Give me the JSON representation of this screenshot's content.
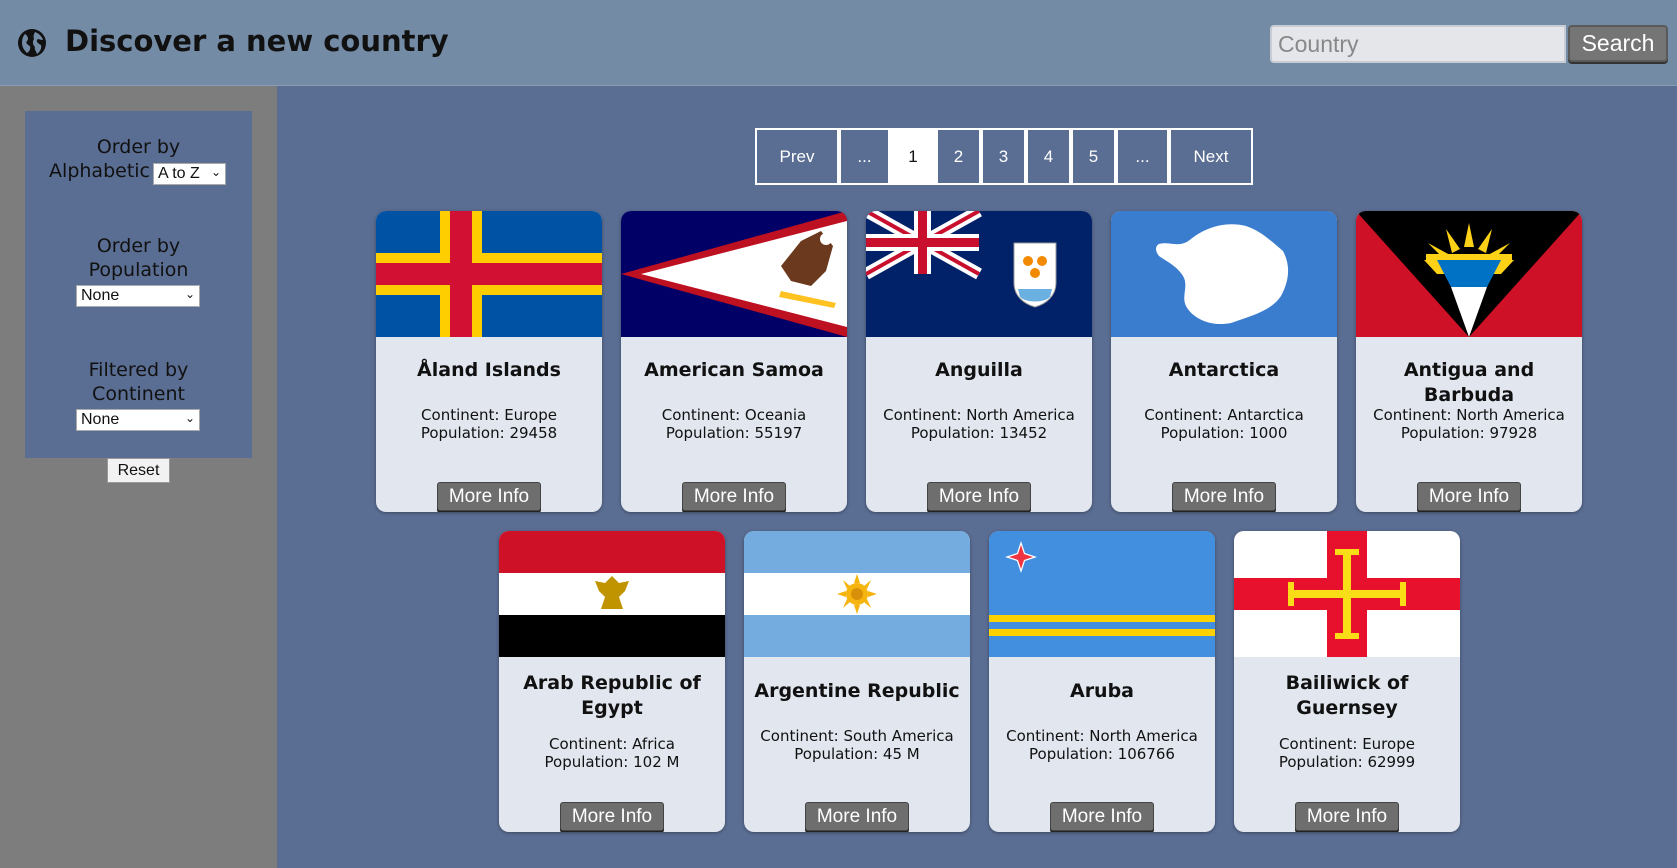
{
  "header": {
    "title": "Discover a new country",
    "search_placeholder": "Country",
    "search_value": "",
    "search_label": "Search"
  },
  "filters": {
    "alphabetic": {
      "label_line1": "Order by",
      "label_line2": "Alphabetic",
      "value": "A to Z"
    },
    "population": {
      "label_line1": "Order by",
      "label_line2": "Population",
      "value": "None"
    },
    "continent": {
      "label_line1": "Filtered by",
      "label_line2": "Continent",
      "value": "None"
    },
    "reset_label": "Reset"
  },
  "pagination": {
    "prev": "Prev",
    "ellipsis_left": "...",
    "pages": [
      "1",
      "2",
      "3",
      "4",
      "5"
    ],
    "ellipsis_right": "...",
    "next": "Next",
    "current": "1"
  },
  "more_info_label": "More Info",
  "countries": [
    {
      "name": "Åland Islands",
      "continent": "Continent: Europe",
      "population": "Population: 29458"
    },
    {
      "name": "American Samoa",
      "continent": "Continent: Oceania",
      "population": "Population: 55197"
    },
    {
      "name": "Anguilla",
      "continent": "Continent: North America",
      "population": "Population: 13452"
    },
    {
      "name": "Antarctica",
      "continent": "Continent: Antarctica",
      "population": "Population: 1000"
    },
    {
      "name": "Antigua and Barbuda",
      "continent": "Continent: North America",
      "population": "Population: 97928"
    },
    {
      "name": "Arab Republic of Egypt",
      "continent": "Continent: Africa",
      "population": "Population: 102 M"
    },
    {
      "name": "Argentine Republic",
      "continent": "Continent: South America",
      "population": "Population: 45 M"
    },
    {
      "name": "Aruba",
      "continent": "Continent: North America",
      "population": "Population: 106766"
    },
    {
      "name": "Bailiwick of Guernsey",
      "continent": "Continent: Europe",
      "population": "Population: 62999"
    }
  ]
}
